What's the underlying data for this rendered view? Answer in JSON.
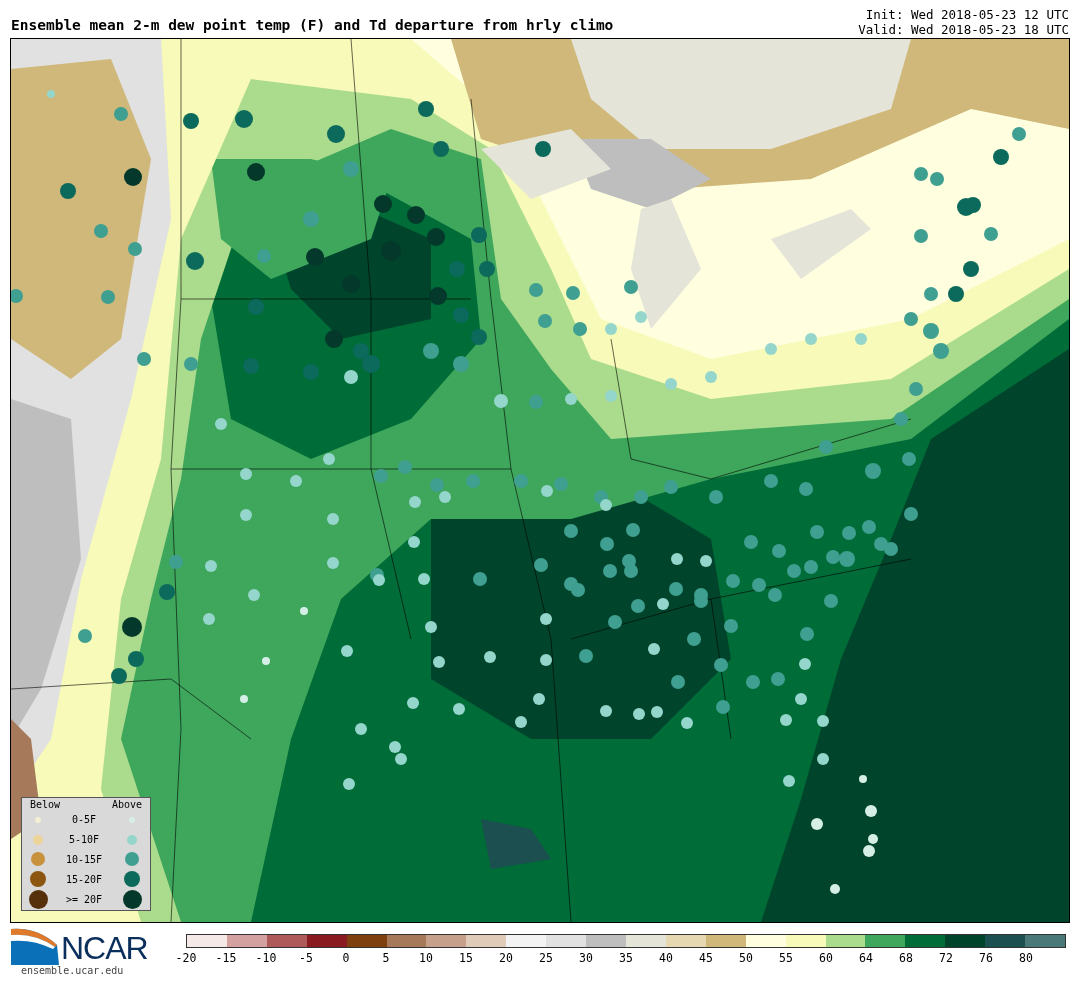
{
  "header": {
    "title": "Ensemble mean 2-m dew point temp (F) and Td departure from hrly climo",
    "init": "Init: Wed 2018-05-23 12 UTC",
    "valid": "Valid: Wed 2018-05-23 18 UTC"
  },
  "legend": {
    "below_heading": "Below",
    "above_heading": "Above",
    "rows": [
      {
        "label": "0-5F",
        "dots": [
          {
            "color": "#f3efd2"
          },
          {
            "color": "#d6efe6"
          }
        ]
      },
      {
        "label": "5-10F",
        "dots": [
          {
            "color": "#ecd397"
          },
          {
            "color": "#94d6cb"
          }
        ]
      },
      {
        "label": "10-15F",
        "dots": [
          {
            "color": "#c8913c"
          },
          {
            "color": "#3f9f90"
          }
        ]
      },
      {
        "label": "15-20F",
        "dots": [
          {
            "color": "#8c5610"
          },
          {
            "color": "#0b6a5c"
          }
        ]
      },
      {
        "label": ">= 20F",
        "dots": [
          {
            "color": "#55300a"
          },
          {
            "color": "#04382a"
          }
        ]
      }
    ]
  },
  "logo": {
    "wordmark": "NCAR",
    "url": "ensemble.ucar.edu"
  },
  "colorbar": {
    "bins": [
      {
        "color": "#f4e9e7"
      },
      {
        "color": "#d3a2a0"
      },
      {
        "color": "#ae5a5a"
      },
      {
        "color": "#891a20"
      },
      {
        "color": "#7f4010"
      },
      {
        "color": "#a6795b"
      },
      {
        "color": "#c6a08a"
      },
      {
        "color": "#e0cbb9"
      },
      {
        "color": "#f3f3f3"
      },
      {
        "color": "#e1e1e1"
      },
      {
        "color": "#bebebe"
      },
      {
        "color": "#e4e4d8"
      },
      {
        "color": "#e6d8b0"
      },
      {
        "color": "#cfb87a"
      },
      {
        "color": "#ffffe0"
      },
      {
        "color": "#f7fab8"
      },
      {
        "color": "#abdb8c"
      },
      {
        "color": "#3ea75c"
      },
      {
        "color": "#006c37"
      },
      {
        "color": "#00452b"
      },
      {
        "color": "#1b4f50"
      },
      {
        "color": "#4a7878"
      }
    ],
    "ticks": [
      "-20",
      "-15",
      "-10",
      "-5",
      "0",
      "5",
      "10",
      "15",
      "20",
      "25",
      "30",
      "35",
      "40",
      "45",
      "50",
      "55",
      "60",
      "64",
      "68",
      "72",
      "76",
      "80"
    ]
  }
}
